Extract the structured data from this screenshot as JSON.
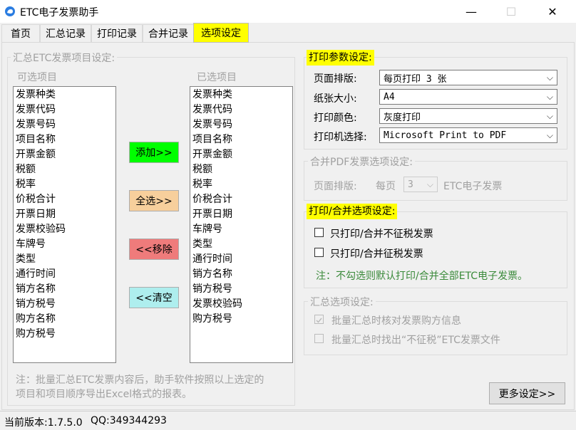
{
  "window": {
    "title": "ETC电子发票助手",
    "minimize": "—",
    "maximize": "☐",
    "close": "✕"
  },
  "tabs": [
    "首页",
    "汇总记录",
    "打印记录",
    "合并记录",
    "选项设定"
  ],
  "summary_group": {
    "legend": "汇总ETC发票项目设定:",
    "available_label": "可选项目",
    "selected_label": "已选项目",
    "available_items": [
      "发票种类",
      "发票代码",
      "发票号码",
      "项目名称",
      "开票金额",
      "税额",
      "税率",
      "价税合计",
      "开票日期",
      "发票校验码",
      "车牌号",
      "类型",
      "通行时间",
      "销方名称",
      "销方税号",
      "购方名称",
      "购方税号"
    ],
    "selected_items": [
      "发票种类",
      "发票代码",
      "发票号码",
      "项目名称",
      "开票金额",
      "税额",
      "税率",
      "价税合计",
      "开票日期",
      "车牌号",
      "类型",
      "通行时间",
      "销方名称",
      "销方税号",
      "发票校验码",
      "购方税号"
    ],
    "add_button": "添加>>",
    "select_all_button": "全选>>",
    "remove_button": "<<移除",
    "clear_button": "<<清空",
    "note_line1": "注：批量汇总ETC发票内容后，助手软件按照以上选定的",
    "note_line2": "项目和项目顺序导出Excel格式的报表。",
    "colors": {
      "add": "#00ff00",
      "select_all": "#f7cf9c",
      "remove": "#ef7b7b",
      "clear": "#aeeeee"
    }
  },
  "print_group": {
    "legend": "打印参数设定:",
    "layout_label": "页面排版:",
    "layout_value": "每页打印 3 张",
    "paper_label": "纸张大小:",
    "paper_value": "A4",
    "color_label": "打印颜色:",
    "color_value": "灰度打印",
    "printer_label": "打印机选择:",
    "printer_value": "Microsoft Print to PDF"
  },
  "merge_group": {
    "legend": "合并PDF发票选项设定:",
    "layout_label": "页面排版:",
    "per_page": "每页",
    "count_value": "3",
    "suffix": "ETC电子发票"
  },
  "print_merge_group": {
    "legend": "打印/合并选项设定:",
    "option1": "只打印/合并不征税发票",
    "option2": "只打印/合并征税发票",
    "note": "注：不勾选则默认打印/合并全部ETC电子发票。",
    "note_color": "#3a8a3a"
  },
  "summary_options_group": {
    "legend": "汇总选项设定:",
    "option1": "批量汇总时核对发票购方信息",
    "option2": "批量汇总时找出“不征税”ETC发票文件"
  },
  "more_settings_button": "更多设定>>",
  "status": {
    "version": "当前版本:1.7.5.0",
    "qq": "QQ:349344293"
  }
}
